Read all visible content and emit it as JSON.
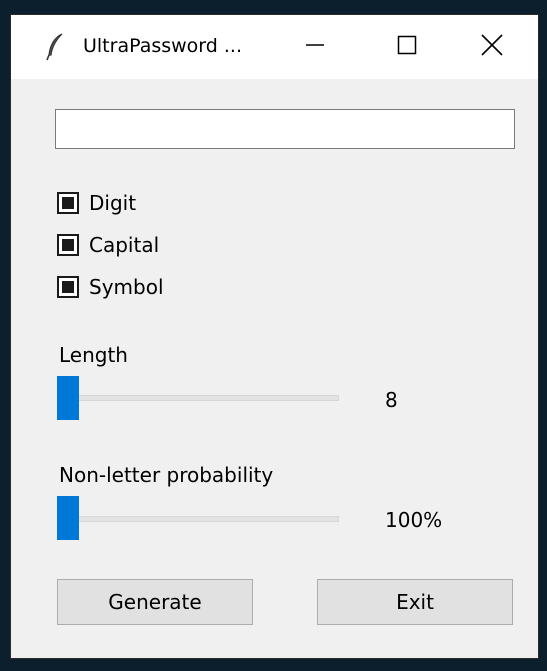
{
  "window": {
    "title": "UltraPassword ...",
    "icon": "feather-icon",
    "controls": [
      "minimize-icon",
      "maximize-icon",
      "close-icon"
    ]
  },
  "password_field": {
    "value": ""
  },
  "options": [
    {
      "label": "Digit",
      "checked": true
    },
    {
      "label": "Capital",
      "checked": true
    },
    {
      "label": "Symbol",
      "checked": true
    }
  ],
  "length": {
    "label": "Length",
    "value": "8",
    "slider_fraction": 0.0
  },
  "probability": {
    "label": "Non-letter probability",
    "value": "100%",
    "slider_fraction": 0.0
  },
  "buttons": {
    "generate": "Generate",
    "exit": "Exit"
  },
  "colors": {
    "accent": "#0078d7",
    "window_bg": "#f0f0f0",
    "desktop_bg": "#0b1f2c"
  }
}
